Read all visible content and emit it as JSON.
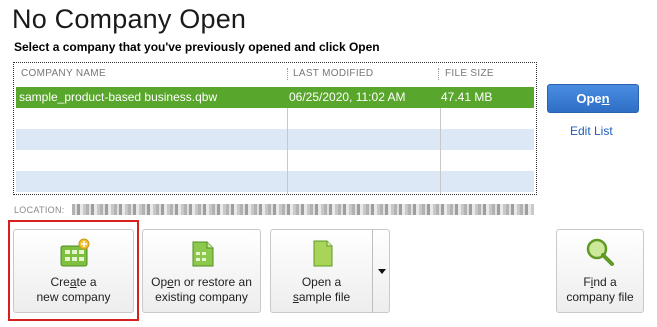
{
  "header": {
    "title": "No Company Open",
    "subtitle": "Select a company that you've previously opened and click Open"
  },
  "table": {
    "columns": [
      "COMPANY NAME",
      "LAST MODIFIED",
      "FILE SIZE"
    ],
    "rows": [
      {
        "company": "sample_product-based business.qbw",
        "modified": "06/25/2020, 11:02 AM",
        "size": "47.41 MB",
        "selected": true
      }
    ]
  },
  "actions": {
    "open_prefix": "Ope",
    "open_underlined": "n",
    "edit_list": "Edit List"
  },
  "location": {
    "label": "LOCATION:"
  },
  "tiles": {
    "create": {
      "line1_a": "Cre",
      "line1_u": "a",
      "line1_b": "te a",
      "line2": "new company",
      "icon": "create-company-icon"
    },
    "restore": {
      "line1_a": "Op",
      "line1_u": "e",
      "line1_b": "n or restore an",
      "line2": "existing company",
      "icon": "open-restore-icon"
    },
    "sample": {
      "line1": "Open a",
      "line2_u": "s",
      "line2_b": "ample file",
      "icon": "sample-file-icon"
    },
    "find": {
      "line1_a": "F",
      "line1_u": "i",
      "line1_b": "nd a",
      "line2": "company file",
      "icon": "find-magnifier-icon"
    }
  },
  "colors": {
    "selected_row": "#58a62b",
    "alt_row": "#dde8f6",
    "open_button": "#3a7dd6",
    "highlight_border": "#d61f1f",
    "link": "#1f5fb8"
  }
}
